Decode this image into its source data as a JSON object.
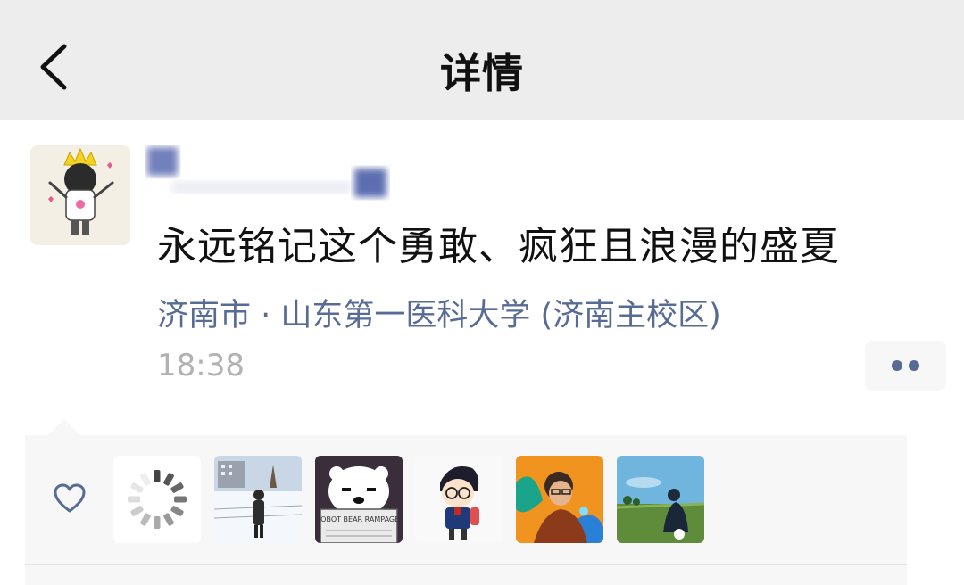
{
  "nav": {
    "title": "详情"
  },
  "post": {
    "text": "永远铭记这个勇敢、疯狂且浪漫的盛夏",
    "location": "济南市 · 山东第一医科大学 (济南主校区)",
    "time": "18:38"
  },
  "colors": {
    "link": "#576b95",
    "nav_bg": "#ededed",
    "panel_bg": "#f7f7f7",
    "time": "#b2b2b2"
  },
  "likes": {
    "icon": "heart-outline-icon",
    "users": [
      {
        "avatar": "loading-spinner"
      },
      {
        "avatar": "snow-scene-photo"
      },
      {
        "avatar": "polar-bear-reading-newspaper"
      },
      {
        "avatar": "cartoon-boy-with-glasses"
      },
      {
        "avatar": "orange-portrait-illustration"
      },
      {
        "avatar": "person-on-grass-field-photo"
      }
    ],
    "avatar_text": {
      "robot_bear": "ROBOT BEAR RAMPAGE!"
    }
  }
}
